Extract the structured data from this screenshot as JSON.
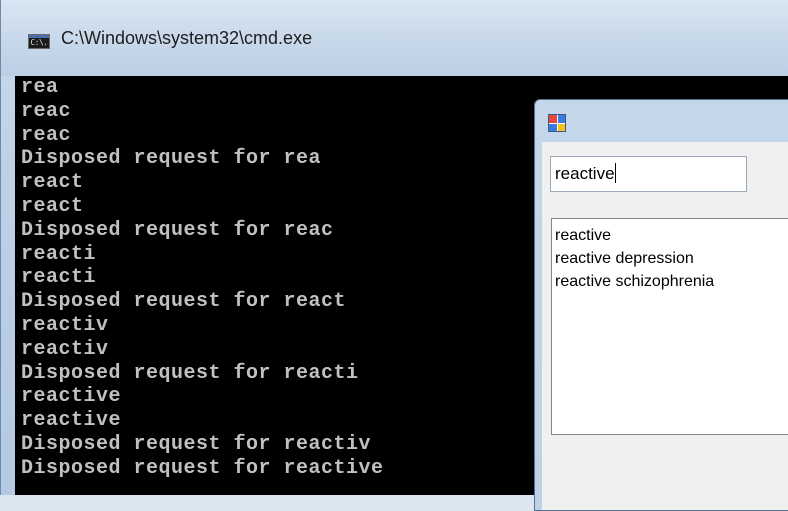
{
  "console": {
    "title": "C:\\Windows\\system32\\cmd.exe",
    "icon_text": "C:\\.",
    "lines": [
      "rea",
      "reac",
      "reac",
      "Disposed request for rea",
      "react",
      "react",
      "Disposed request for reac",
      "reacti",
      "reacti",
      "Disposed request for react",
      "reactiv",
      "reactiv",
      "Disposed request for reacti",
      "reactive",
      "reactive",
      "Disposed request for reactiv",
      "Disposed request for reactive"
    ]
  },
  "dialog": {
    "icon": "winforms-app-icon",
    "search_value": "reactive",
    "suggestions": [
      "reactive",
      "reactive depression",
      "reactive schizophrenia"
    ]
  }
}
